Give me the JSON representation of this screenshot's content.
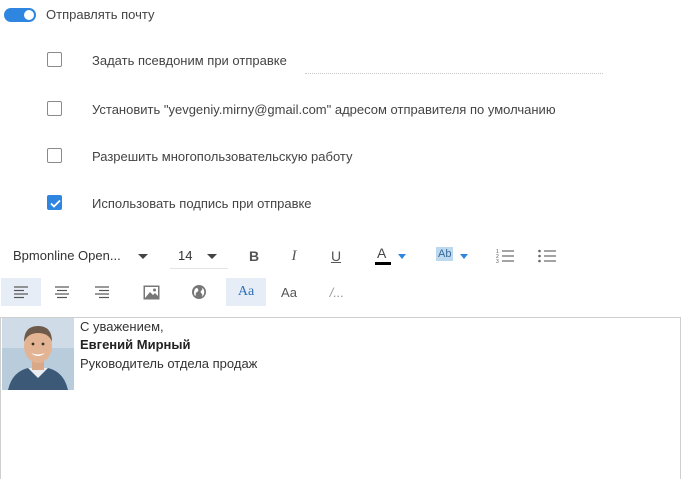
{
  "send_mail": {
    "label": "Отправлять почту",
    "enabled": true
  },
  "options": [
    {
      "label": "Задать псевдоним при отправке",
      "checked": false
    },
    {
      "label": "Установить \"yevgeniy.mirny@gmail.com\" адресом отправителя по умолчанию",
      "checked": false
    },
    {
      "label": "Разрешить многопользовательскую работу",
      "checked": false
    },
    {
      "label": "Использовать подпись при отправке",
      "checked": true
    }
  ],
  "toolbar": {
    "font_family": "Bpmonline Open...",
    "font_size": "14",
    "bold": "B",
    "italic": "I",
    "underline": "U",
    "font_color_letter": "A",
    "bg_color_label": "Ab",
    "style_label": "Aa",
    "style2_label": "Aa",
    "clear_label": "/..."
  },
  "signature": {
    "greeting": "С уважением,",
    "name": "Евгений Мирный",
    "title": "Руководитель отдела продаж"
  },
  "colors": {
    "accent": "#2f86e0",
    "active_tool_bg": "#e6edf6"
  }
}
